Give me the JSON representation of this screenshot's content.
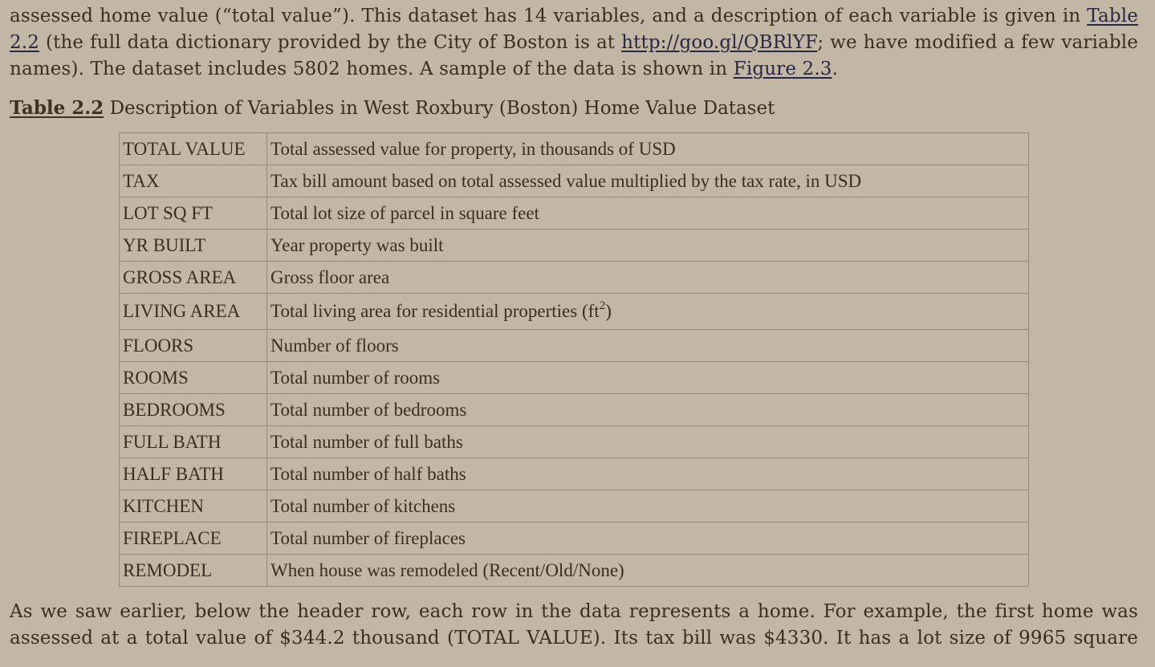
{
  "intro": {
    "line1_pre": "assessed home value (“total value”). This dataset has 14 variables, and a description of each variable is given in ",
    "line1_link": "Table",
    "line2_link": "2.2",
    "line2_mid": " (the full data dictionary provided by the City of Boston is at ",
    "line2_url": "http://goo.gl/QBRlYF",
    "line2_post": "; we have modified a few variable",
    "line3_pre": "names). The dataset includes 5802 homes. A sample of the data is shown in ",
    "line3_link": "Figure 2.3",
    "line3_post": "."
  },
  "caption": {
    "label": "Table 2.2",
    "text": " Description of Variables in West Roxbury (Boston) Home Value Dataset"
  },
  "table": {
    "rows": [
      {
        "name": "TOTAL VALUE",
        "description": "Total assessed value for property, in thousands of USD"
      },
      {
        "name": "TAX",
        "description": "Tax bill amount based on total assessed value multiplied by the tax rate, in USD"
      },
      {
        "name": "LOT SQ FT",
        "description": "Total lot size of parcel in square feet"
      },
      {
        "name": "YR BUILT",
        "description": "Year property was built"
      },
      {
        "name": "GROSS AREA",
        "description": "Gross floor area"
      },
      {
        "name": "LIVING AREA",
        "description": "Total living area for residential properties (ft",
        "superscript": "2",
        "suffix": ")"
      },
      {
        "name": "FLOORS",
        "description": "Number of floors"
      },
      {
        "name": "ROOMS",
        "description": "Total number of rooms"
      },
      {
        "name": "BEDROOMS",
        "description": "Total number of bedrooms"
      },
      {
        "name": "FULL BATH",
        "description": "Total number of full baths"
      },
      {
        "name": "HALF BATH",
        "description": "Total number of half baths"
      },
      {
        "name": "KITCHEN",
        "description": "Total number of kitchens"
      },
      {
        "name": "FIREPLACE",
        "description": "Total number of fireplaces"
      },
      {
        "name": "REMODEL",
        "description": "When house was remodeled (Recent/Old/None)"
      }
    ]
  },
  "outro": {
    "line1": "As we saw earlier, below the header row, each row in the data represents a home. For example, the first home was",
    "line2": "assessed at a total value of $344.2 thousand (TOTAL VALUE). Its tax bill was $4330. It has a lot size of 9965 square"
  },
  "colors": {
    "background": "#c1b7a4",
    "text": "#3a2e22",
    "link": "#2a2744",
    "table_border": "#958b7b"
  }
}
